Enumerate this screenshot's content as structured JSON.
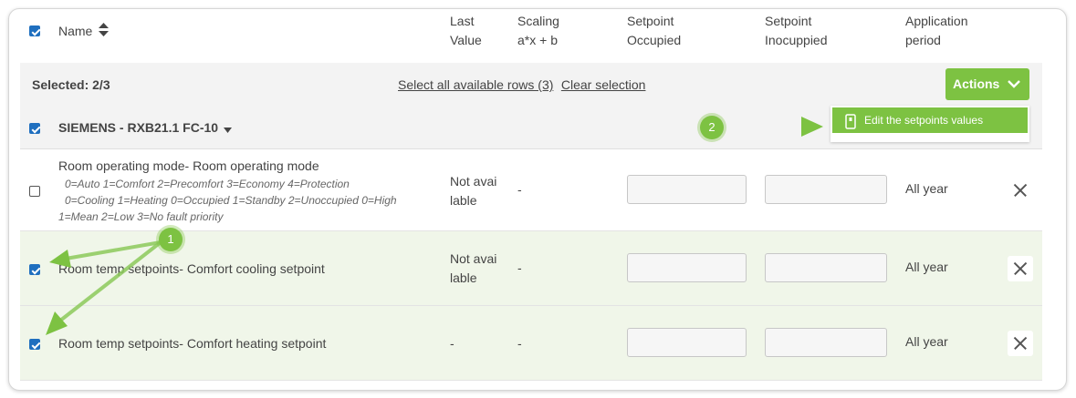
{
  "header": {
    "name": "Name",
    "last_value": [
      "Last",
      "Value"
    ],
    "scaling": [
      "Scaling",
      "a*x + b"
    ],
    "setpoint_occupied": [
      "Setpoint",
      "Occupied"
    ],
    "setpoint_unoccupied": [
      "Setpoint",
      "Inocuppied"
    ],
    "application_period": [
      "Application",
      "period"
    ]
  },
  "selection": {
    "selected": "Selected: 2/3",
    "select_all": "Select all available rows (3)",
    "clear": "Clear selection"
  },
  "actions": {
    "label": "Actions",
    "menu_item": "Edit the setpoints values"
  },
  "device": {
    "name": "SIEMENS - RXB21.1 FC-10"
  },
  "rows": [
    {
      "checked": false,
      "name": "Room operating mode- Room operating mode",
      "enum": [
        "0=Auto 1=Comfort 2=Precomfort 3=Economy 4=Protection",
        "0=Cooling 1=Heating 0=Occupied 1=Standby 2=Unoccupied 0=High",
        "1=Mean 2=Low 3=No fault priority"
      ],
      "last_value": [
        "Not avai",
        "lable"
      ],
      "scaling": "-",
      "period": "All year"
    },
    {
      "checked": true,
      "name": "Room temp setpoints- Comfort cooling setpoint",
      "last_value": [
        "Not avai",
        "lable"
      ],
      "scaling": "-",
      "period": "All year"
    },
    {
      "checked": true,
      "name": "Room temp setpoints- Comfort heating setpoint",
      "last_value": "-",
      "scaling": "-",
      "period": "All year"
    }
  ],
  "annotations": {
    "step1": "1",
    "step2": "2"
  },
  "colors": {
    "accent": "#7dc242",
    "checkbox": "#1f6fbf",
    "selected_row": "#f0f6e9"
  }
}
